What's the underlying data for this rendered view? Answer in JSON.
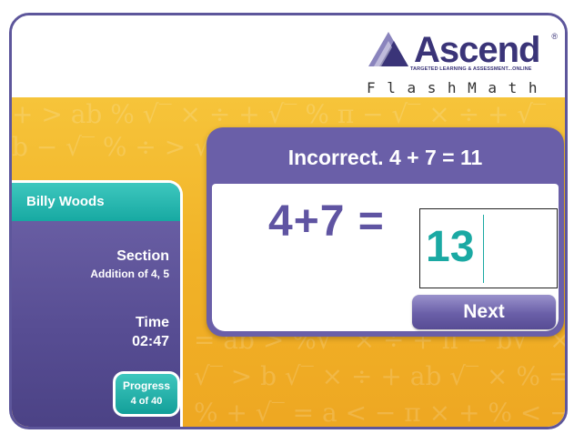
{
  "brand": {
    "name": "Ascend",
    "registered": "®",
    "tagline": "TARGETED LEARNING & ASSESSMENT...ONLINE",
    "product": "FlashMath"
  },
  "background_symbols": [
    "+ > ab % √‾ × ÷ + √‾ % π − √‾ × ÷ + √‾",
    "b − √‾ % ÷ > √‾ ÷ + √‾ % π × ÷ + ab",
    "= ab > %√‾ × ÷ + π − b√‾ ×",
    "√‾ > b √‾ × ÷ + ab √‾ × % =",
    "% + √‾ = a < − π × + % < − √‾"
  ],
  "student": {
    "name": "Billy Woods"
  },
  "section": {
    "label": "Section",
    "value": "Addition of 4, 5"
  },
  "time": {
    "label": "Time",
    "value": "02:47"
  },
  "progress": {
    "label": "Progress",
    "value": "4 of 40"
  },
  "feedback": {
    "title": "Incorrect.  4 + 7 = 11"
  },
  "problem": {
    "equation": "4+7 =",
    "answer": "13"
  },
  "actions": {
    "next_label": "Next"
  },
  "colors": {
    "purple": "#6a5fa8",
    "teal": "#1aa9a3",
    "gold": "#f1b227"
  }
}
